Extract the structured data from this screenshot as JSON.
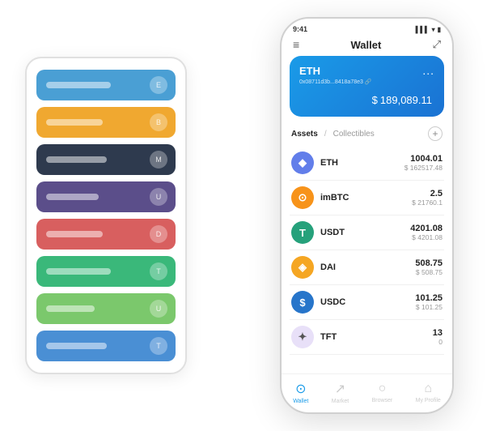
{
  "scene": {
    "cardStack": {
      "cards": [
        {
          "id": "card-blue",
          "color": "#4a9fd4",
          "lineWidth": "80px",
          "iconText": "E"
        },
        {
          "id": "card-orange",
          "color": "#f0a830",
          "lineWidth": "70px",
          "iconText": "B"
        },
        {
          "id": "card-dark",
          "color": "#2e3a4e",
          "lineWidth": "75px",
          "iconText": "M"
        },
        {
          "id": "card-purple",
          "color": "#5b4e8a",
          "lineWidth": "65px",
          "iconText": "U"
        },
        {
          "id": "card-red",
          "color": "#d85f5f",
          "lineWidth": "70px",
          "iconText": "D"
        },
        {
          "id": "card-green",
          "color": "#3ab87a",
          "lineWidth": "80px",
          "iconText": "T"
        },
        {
          "id": "card-lightgreen",
          "color": "#7bc86c",
          "lineWidth": "60px",
          "iconText": "U"
        },
        {
          "id": "card-blue2",
          "color": "#4a8fd4",
          "lineWidth": "75px",
          "iconText": "T"
        }
      ]
    },
    "phone": {
      "statusBar": {
        "time": "9:41",
        "signal": "▌▌▌",
        "wifi": "▾",
        "battery": "▮"
      },
      "header": {
        "menuIcon": "≡",
        "title": "Wallet",
        "scanIcon": "⤢"
      },
      "ethCard": {
        "title": "ETH",
        "dots": "...",
        "address": "0x08711d3b...8418a78e3 🔗",
        "currencySymbol": "$",
        "amount": "189,089.11"
      },
      "assetsSection": {
        "activeTab": "Assets",
        "divider": "/",
        "inactiveTab": "Collectibles",
        "addIcon": "+"
      },
      "assetList": [
        {
          "name": "ETH",
          "icon": "🔷",
          "iconBg": "#627eea",
          "amount": "1004.01",
          "usd": "$ 162517.48"
        },
        {
          "name": "imBTC",
          "icon": "◎",
          "iconBg": "#f7931a",
          "amount": "2.5",
          "usd": "$ 21760.1"
        },
        {
          "name": "USDT",
          "icon": "T",
          "iconBg": "#26a17b",
          "amount": "4201.08",
          "usd": "$ 4201.08"
        },
        {
          "name": "DAI",
          "icon": "⬡",
          "iconBg": "#f5a623",
          "amount": "508.75",
          "usd": "$ 508.75"
        },
        {
          "name": "USDC",
          "icon": "$",
          "iconBg": "#2775ca",
          "amount": "101.25",
          "usd": "$ 101.25"
        },
        {
          "name": "TFT",
          "icon": "🌿",
          "iconBg": "#e8f0fe",
          "amount": "13",
          "usd": "0"
        }
      ],
      "bottomNav": [
        {
          "id": "wallet",
          "icon": "⊙",
          "label": "Wallet",
          "active": true
        },
        {
          "id": "market",
          "icon": "📊",
          "label": "Market",
          "active": false
        },
        {
          "id": "browser",
          "icon": "👤",
          "label": "Browser",
          "active": false
        },
        {
          "id": "profile",
          "icon": "👤",
          "label": "My Profile",
          "active": false
        }
      ]
    }
  }
}
